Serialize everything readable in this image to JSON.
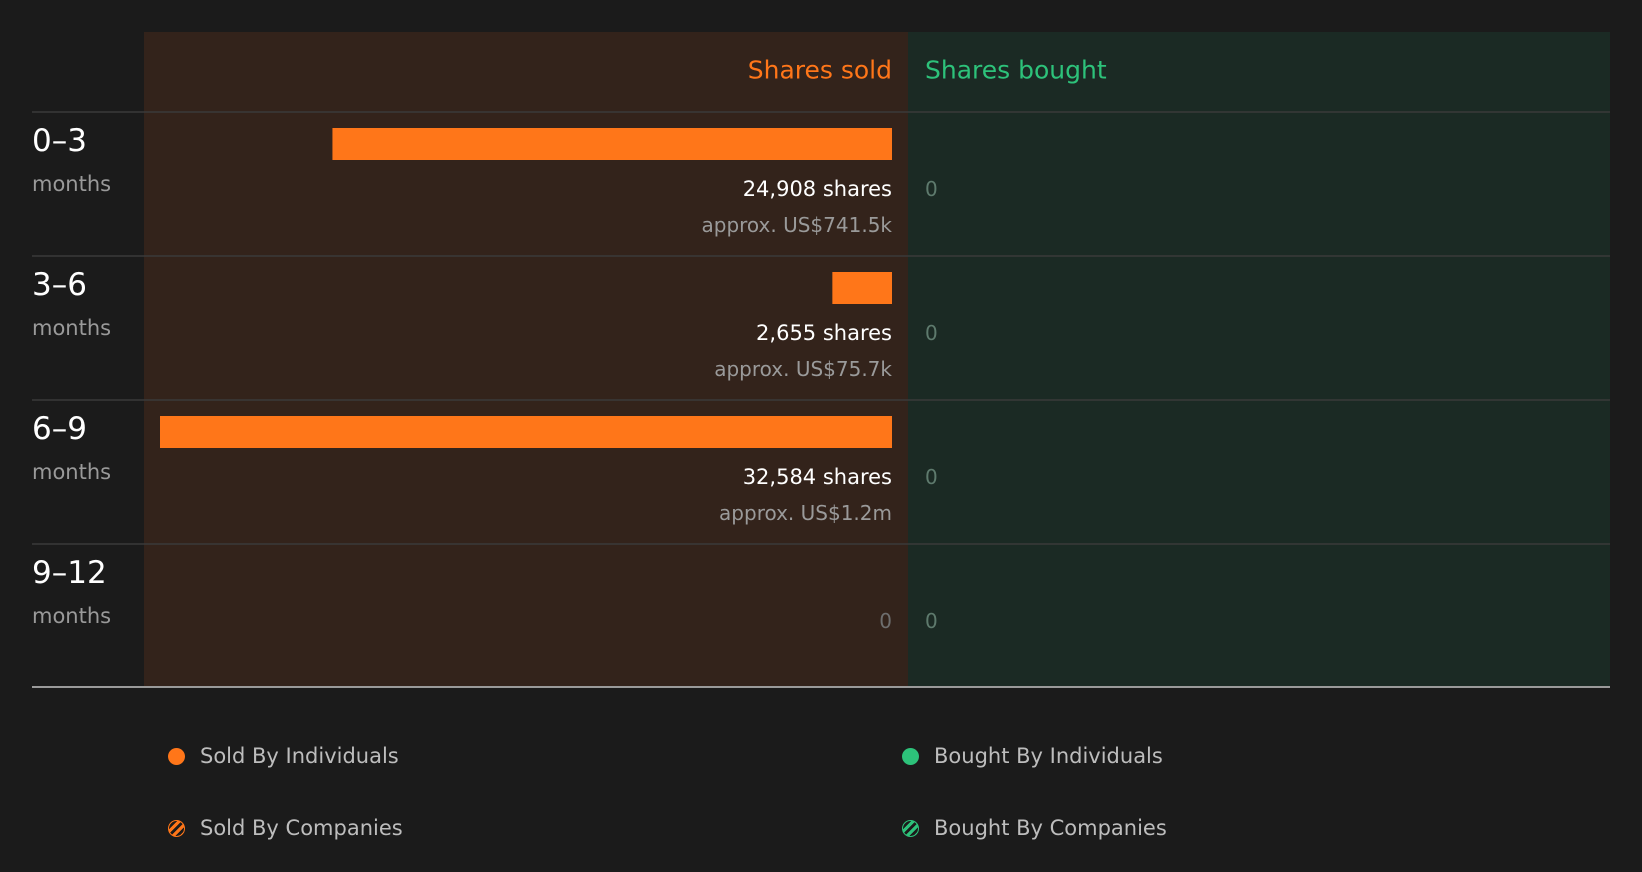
{
  "chart_data": {
    "type": "bar",
    "headers": {
      "sold": "Shares sold",
      "bought": "Shares bought"
    },
    "categories": [
      {
        "range": "0–3",
        "unit": "months"
      },
      {
        "range": "3–6",
        "unit": "months"
      },
      {
        "range": "6–9",
        "unit": "months"
      },
      {
        "range": "9–12",
        "unit": "months"
      }
    ],
    "series": [
      {
        "name": "Shares sold",
        "values": [
          24908,
          2655,
          32584,
          0
        ],
        "value_labels": [
          "24,908 shares",
          "2,655 shares",
          "32,584 shares",
          "0"
        ],
        "approx_labels": [
          "approx. US$741.5k",
          "approx. US$75.7k",
          "approx. US$1.2m",
          ""
        ]
      },
      {
        "name": "Shares bought",
        "values": [
          0,
          0,
          0,
          0
        ],
        "value_labels": [
          "0",
          "0",
          "0",
          "0"
        ]
      }
    ],
    "legend": [
      {
        "label": "Sold By Individuals",
        "style": "solid",
        "color": "#ff7619"
      },
      {
        "label": "Bought By Individuals",
        "style": "solid",
        "color": "#2dc27a"
      },
      {
        "label": "Sold By Companies",
        "style": "hatched",
        "color": "#ff7619"
      },
      {
        "label": "Bought By Companies",
        "style": "hatched",
        "color": "#2dc27a"
      }
    ],
    "legend_placement": "bottom",
    "colors": {
      "sold": "#ff7619",
      "bought": "#2dc27a",
      "sold_panel": "#33231b",
      "bought_panel": "#1b2a24",
      "background": "#1b1b1b"
    }
  }
}
